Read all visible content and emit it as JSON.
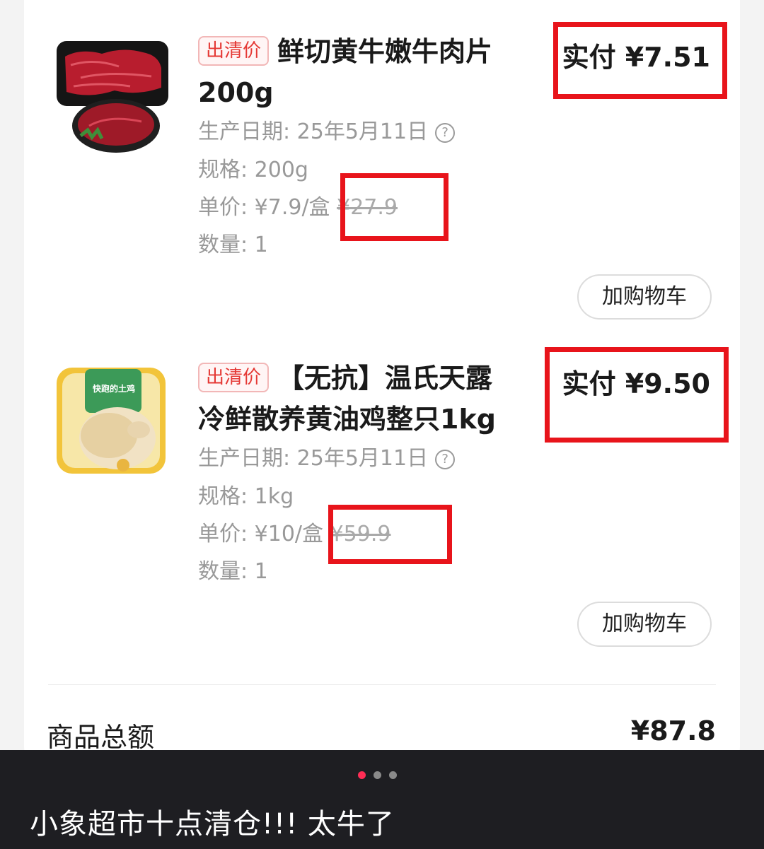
{
  "products": [
    {
      "tag": "出清价",
      "title": "鲜切黄牛嫩牛肉片200g",
      "production_date_label": "生产日期:",
      "production_date": "25年5月11日",
      "spec_label": "规格:",
      "spec": "200g",
      "unit_price_label": "单价:",
      "unit_price": "¥7.9/盒",
      "original_price": "¥27.9",
      "quantity_label": "数量:",
      "quantity": "1",
      "paid": "实付 ¥7.51",
      "add_to_cart": "加购物车",
      "image_icon": "beef-slices-image"
    },
    {
      "tag": "出清价",
      "title": "【无抗】温氏天露冷鲜散养黄油鸡整只1kg",
      "production_date_label": "生产日期:",
      "production_date": "25年5月11日",
      "spec_label": "规格:",
      "spec": "1kg",
      "unit_price_label": "单价:",
      "unit_price": "¥10/盒",
      "original_price": "¥59.9",
      "quantity_label": "数量:",
      "quantity": "1",
      "paid": "实付 ¥9.50",
      "add_to_cart": "加购物车",
      "image_icon": "whole-chicken-image",
      "package_text": "快跑的土鸡"
    }
  ],
  "summary": {
    "total_label": "商品总额",
    "total_value": "¥87.8"
  },
  "caption": {
    "text": "小象超市十点清仓!!! 太牛了",
    "page_index": 1,
    "page_count": 3
  },
  "colors": {
    "accent_red": "#e8141b",
    "tag_red": "#e53935",
    "active_dot": "#ff2d55"
  }
}
